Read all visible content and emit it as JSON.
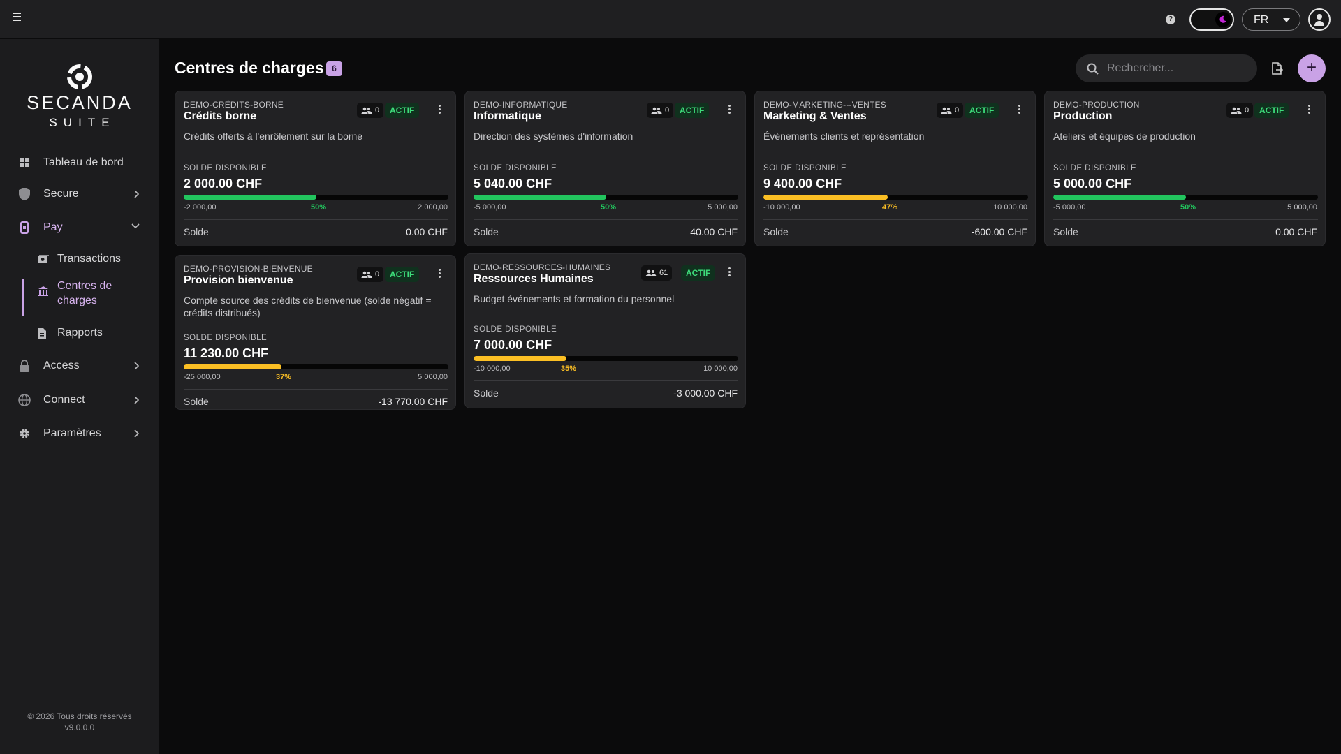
{
  "language": "FR",
  "brand": {
    "name": "SECANDA",
    "suite": "SUITE"
  },
  "sidebar": {
    "items": [
      {
        "label": "Tableau de bord",
        "icon": "grid-icon"
      },
      {
        "label": "Secure",
        "icon": "shield-icon"
      },
      {
        "label": "Pay",
        "icon": "phone-pay-icon"
      },
      {
        "label": "Access",
        "icon": "lock-icon"
      },
      {
        "label": "Connect",
        "icon": "globe-icon"
      },
      {
        "label": "Paramètres",
        "icon": "gear-icon"
      }
    ],
    "pay_subitems": [
      {
        "label": "Transactions",
        "icon": "money-icon"
      },
      {
        "label": "Centres de charges",
        "icon": "bank-icon"
      },
      {
        "label": "Rapports",
        "icon": "report-icon"
      }
    ],
    "footer_copyright": "© 2026 Tous droits réservés",
    "footer_version": "v9.0.0.0"
  },
  "header": {
    "title": "Centres de charges",
    "count": "6",
    "search_placeholder": "Rechercher..."
  },
  "labels": {
    "available": "SOLDE DISPONIBLE",
    "balance": "Solde"
  },
  "colors": {
    "accent": "#c9a2e6",
    "progress_green": "#22c55e",
    "progress_orange": "#fbbf24",
    "status_green": "#3ddc7a"
  },
  "cards": [
    {
      "code": "DEMO-CRÉDITS-BORNE",
      "name": "Crédits borne",
      "members": "0",
      "status": "ACTIF",
      "description": "Crédits offerts à l'enrôlement sur la borne",
      "available": "2 000.00 CHF",
      "progress": 0.5,
      "percent": "50%",
      "min": "-2 000,00",
      "max": "2 000,00",
      "balance": "0.00 CHF"
    },
    {
      "code": "DEMO-INFORMATIQUE",
      "name": "Informatique",
      "members": "0",
      "status": "ACTIF",
      "description": "Direction des systèmes d'information",
      "available": "5 040.00 CHF",
      "progress": 0.5,
      "percent": "50%",
      "min": "-5 000,00",
      "max": "5 000,00",
      "balance": "40.00 CHF"
    },
    {
      "code": "DEMO-MARKETING---VENTES",
      "name": "Marketing & Ventes",
      "members": "0",
      "status": "ACTIF",
      "description": "Événements clients et représentation",
      "available": "9 400.00 CHF",
      "progress": 0.47,
      "percent": "47%",
      "min": "-10 000,00",
      "max": "10 000,00",
      "balance": "-600.00 CHF"
    },
    {
      "code": "DEMO-PRODUCTION",
      "name": "Production",
      "members": "0",
      "status": "ACTIF",
      "description": "Ateliers et équipes de production",
      "available": "5 000.00 CHF",
      "progress": 0.5,
      "percent": "50%",
      "min": "-5 000,00",
      "max": "5 000,00",
      "balance": "0.00 CHF"
    },
    {
      "code": "DEMO-PROVISION-BIENVENUE",
      "name": "Provision bienvenue",
      "members": "0",
      "status": "ACTIF",
      "description": "Compte source des crédits de bienvenue (solde négatif = crédits distribués)",
      "available": "11 230.00 CHF",
      "progress": 0.37,
      "percent": "37%",
      "min": "-25 000,00",
      "max": "5 000,00",
      "balance": "-13 770.00 CHF"
    },
    {
      "code": "DEMO-RESSOURCES-HUMAINES",
      "name": "Ressources Humaines",
      "members": "61",
      "status": "ACTIF",
      "description": "Budget événements et formation du personnel",
      "available": "7 000.00 CHF",
      "progress": 0.35,
      "percent": "35%",
      "min": "-10 000,00",
      "max": "10 000,00",
      "balance": "-3 000.00 CHF"
    }
  ]
}
